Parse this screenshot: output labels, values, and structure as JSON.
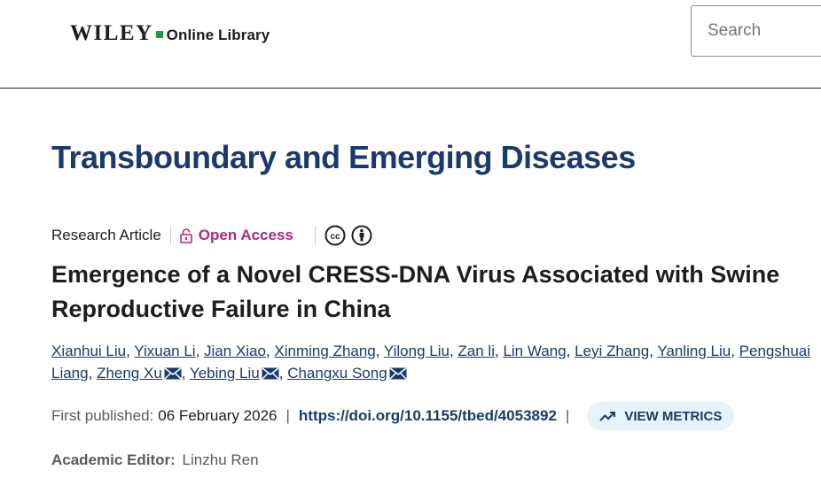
{
  "header": {
    "logo_word": "WILEY",
    "logo_sub": "Online Library",
    "search_placeholder": "Search"
  },
  "journal_title": "Transboundary and Emerging Diseases",
  "article": {
    "type": "Research Article",
    "access_label": "Open Access",
    "license_icons": [
      "cc-icon",
      "by-icon"
    ],
    "title": "Emergence of a Novel CRESS-DNA Virus Associated with Swine Reproductive Failure in China",
    "authors": [
      {
        "name": "Xianhui Liu",
        "mail": false
      },
      {
        "name": "Yixuan Li",
        "mail": false
      },
      {
        "name": "Jian Xiao",
        "mail": false
      },
      {
        "name": "Xinming Zhang",
        "mail": false
      },
      {
        "name": "Yilong Liu",
        "mail": false
      },
      {
        "name": "Zan li",
        "mail": false
      },
      {
        "name": "Lin Wang",
        "mail": false
      },
      {
        "name": "Leyi Zhang",
        "mail": false
      },
      {
        "name": "Yanling Liu",
        "mail": false
      },
      {
        "name": "Pengshuai Liang",
        "mail": false
      },
      {
        "name": "Zheng Xu",
        "mail": true
      },
      {
        "name": "Yebing Liu",
        "mail": true
      },
      {
        "name": "Changxu Song",
        "mail": true
      }
    ],
    "first_published_label": "First published:",
    "first_published_date": "06 February 2026",
    "doi": "https://doi.org/10.1155/tbed/4053892",
    "view_metrics_label": "VIEW METRICS",
    "academic_editor_label": "Academic Editor:",
    "academic_editor_name": "Linzhu Ren"
  },
  "colors": {
    "journal_blue": "#1b3a6b",
    "open_access": "#b02a7a",
    "wiley_green": "#1f9a4d",
    "metrics_bg": "#e8f2fb"
  }
}
